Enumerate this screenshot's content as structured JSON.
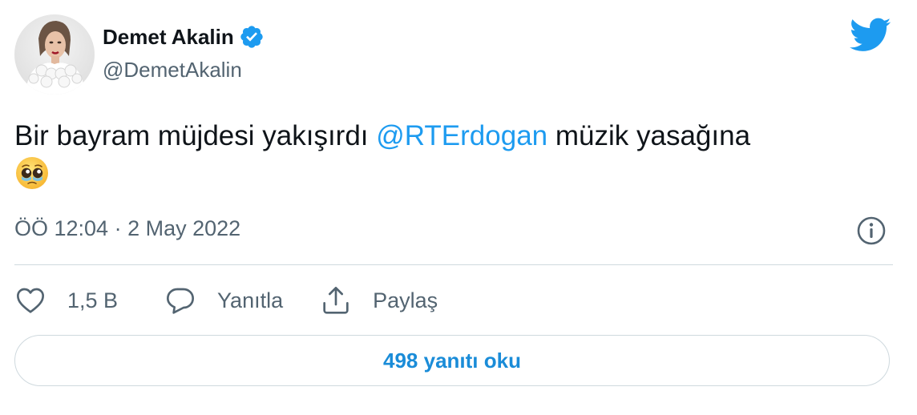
{
  "user": {
    "display_name": "Demet Akalin",
    "handle": "@DemetAkalin",
    "verified": true,
    "avatar_icon": "profile-photo"
  },
  "brand": {
    "icon": "twitter-bird-icon",
    "color": "#1d9bf0"
  },
  "tweet": {
    "text_before": "Bir bayram müjdesi yakışırdı ",
    "mention": "@RTErdogan",
    "text_after": " müzik yasağına",
    "emoji": "pleading-face-emoji"
  },
  "meta": {
    "timestamp": "ÖÖ 12:04 · 2 May 2022",
    "info_icon": "info-icon"
  },
  "actions": [
    {
      "icon": "heart-icon",
      "label": "1,5 B"
    },
    {
      "icon": "reply-bubble-icon",
      "label": "Yanıtla"
    },
    {
      "icon": "share-icon",
      "label": "Paylaş"
    }
  ],
  "read_replies": {
    "label": "498 yanıtı oku"
  },
  "colors": {
    "text_primary": "#0f1419",
    "text_secondary": "#536471",
    "link": "#1d9bf0",
    "border": "#cfd9de"
  }
}
